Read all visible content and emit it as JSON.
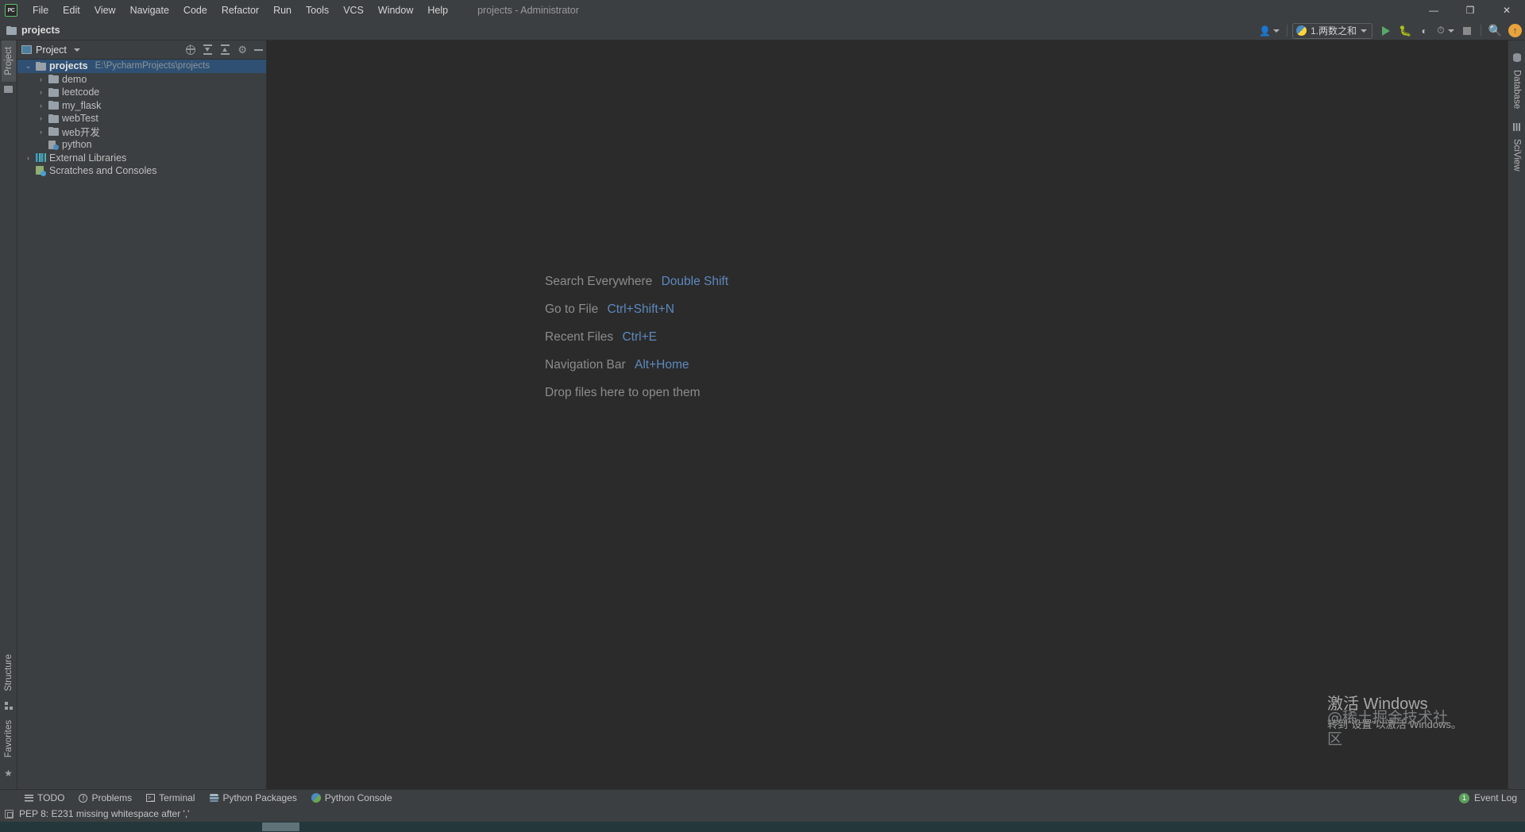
{
  "window": {
    "title": "projects - Administrator",
    "logo_text": "PC",
    "controls": {
      "minimize": "—",
      "restore": "❐",
      "close": "✕"
    }
  },
  "menubar": [
    {
      "label": "File"
    },
    {
      "label": "Edit"
    },
    {
      "label": "View"
    },
    {
      "label": "Navigate"
    },
    {
      "label": "Code"
    },
    {
      "label": "Refactor"
    },
    {
      "label": "Run"
    },
    {
      "label": "Tools"
    },
    {
      "label": "VCS"
    },
    {
      "label": "Window"
    },
    {
      "label": "Help"
    }
  ],
  "navbar": {
    "breadcrumb": "projects",
    "run_config": {
      "label": "1.两数之和",
      "icon": "python-icon"
    },
    "buttons": [
      {
        "name": "user-account",
        "label": ""
      },
      {
        "name": "run",
        "label": ""
      },
      {
        "name": "debug",
        "label": ""
      },
      {
        "name": "run-with-coverage",
        "label": ""
      },
      {
        "name": "profile",
        "label": ""
      },
      {
        "name": "stop",
        "label": ""
      },
      {
        "name": "search",
        "label": ""
      },
      {
        "name": "update-available",
        "label": "↑"
      }
    ]
  },
  "left_rail": {
    "top": [
      {
        "label": "Project",
        "active": true
      }
    ],
    "bottom": [
      {
        "label": "Structure"
      },
      {
        "label": "Favorites"
      }
    ]
  },
  "right_rail": [
    {
      "label": "Database"
    },
    {
      "label": "SciView"
    }
  ],
  "project_panel": {
    "tab_label": "Project",
    "tools": [
      {
        "name": "select-opened-file-icon"
      },
      {
        "name": "expand-all-icon"
      },
      {
        "name": "collapse-all-icon"
      },
      {
        "name": "settings-gear-icon"
      },
      {
        "name": "hide-panel-icon"
      }
    ],
    "tree": [
      {
        "label": "projects",
        "path": "E:\\PycharmProjects\\projects",
        "icon": "folder",
        "arrow": "⌄",
        "depth": 0,
        "bold": true,
        "selected": true
      },
      {
        "label": "demo",
        "path": "",
        "icon": "folder",
        "arrow": "›",
        "depth": 1,
        "bold": false,
        "selected": false
      },
      {
        "label": "leetcode",
        "path": "",
        "icon": "folder",
        "arrow": "›",
        "depth": 1,
        "bold": false,
        "selected": false
      },
      {
        "label": "my_flask",
        "path": "",
        "icon": "folder",
        "arrow": "›",
        "depth": 1,
        "bold": false,
        "selected": false
      },
      {
        "label": "webTest",
        "path": "",
        "icon": "folder",
        "arrow": "›",
        "depth": 1,
        "bold": false,
        "selected": false
      },
      {
        "label": "web开发",
        "path": "",
        "icon": "folder",
        "arrow": "›",
        "depth": 1,
        "bold": false,
        "selected": false
      },
      {
        "label": "python",
        "path": "",
        "icon": "python-module",
        "arrow": "",
        "depth": 1,
        "bold": false,
        "selected": false
      },
      {
        "label": "External Libraries",
        "path": "",
        "icon": "libraries",
        "arrow": "›",
        "depth": 0,
        "bold": false,
        "selected": false
      },
      {
        "label": "Scratches and Consoles",
        "path": "",
        "icon": "scratches",
        "arrow": "",
        "depth": 0,
        "bold": false,
        "selected": false
      }
    ]
  },
  "editor": {
    "hints": [
      {
        "action": "Search Everywhere",
        "shortcut": "Double Shift"
      },
      {
        "action": "Go to File",
        "shortcut": "Ctrl+Shift+N"
      },
      {
        "action": "Recent Files",
        "shortcut": "Ctrl+E"
      },
      {
        "action": "Navigation Bar",
        "shortcut": "Alt+Home"
      },
      {
        "action": "Drop files here to open them",
        "shortcut": ""
      }
    ],
    "watermark": {
      "line1": "激活 Windows",
      "line2": "转到“设置”以激活 Windows。"
    },
    "credit": "@稀土掘金技术社区"
  },
  "bottom_tools": [
    {
      "label": "TODO",
      "icon": "todo-icon"
    },
    {
      "label": "Problems",
      "icon": "problems-icon"
    },
    {
      "label": "Terminal",
      "icon": "terminal-icon"
    },
    {
      "label": "Python Packages",
      "icon": "packages-icon"
    },
    {
      "label": "Python Console",
      "icon": "python-console-icon"
    }
  ],
  "event_log": {
    "label": "Event Log",
    "count": "1"
  },
  "statusbar": {
    "message": "PEP 8: E231 missing whitespace after ','"
  },
  "colors": {
    "accent_blue": "#5c89bf",
    "selection": "#2f5073",
    "editor_bg": "#2b2b2b",
    "chrome_bg": "#3c3f41",
    "run_green": "#59a869",
    "badge_orange": "#e8a33d"
  }
}
